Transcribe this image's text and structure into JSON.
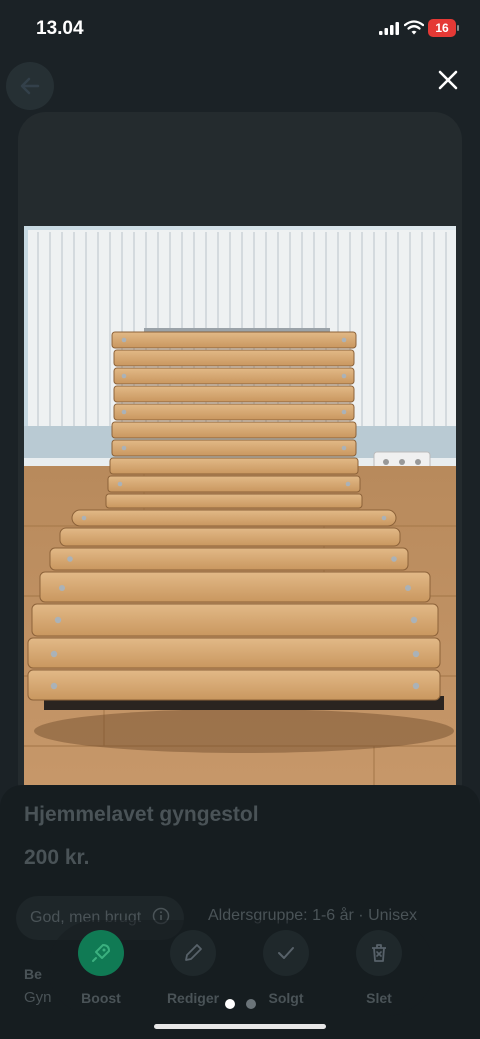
{
  "status": {
    "time": "13.04",
    "battery": "16"
  },
  "listing": {
    "title": "Hjemmelavet gyngestol",
    "price": "200 kr.",
    "condition": "God, men brugt",
    "age_info": "Aldersgruppe: 1-6 år · Unisex",
    "description_label": "Be",
    "description_text": "Gyn"
  },
  "actions": {
    "boost": "Boost",
    "edit": "Rediger",
    "sold": "Solgt",
    "delete": "Slet"
  },
  "carousel": {
    "total": 2,
    "active": 1
  },
  "colors": {
    "accent": "#107a54",
    "battery": "#e53935",
    "background": "#1b2226"
  },
  "icons": [
    "back-arrow-icon",
    "close-icon",
    "rocket-icon",
    "pencil-icon",
    "checkmark-icon",
    "trash-icon",
    "info-icon"
  ]
}
